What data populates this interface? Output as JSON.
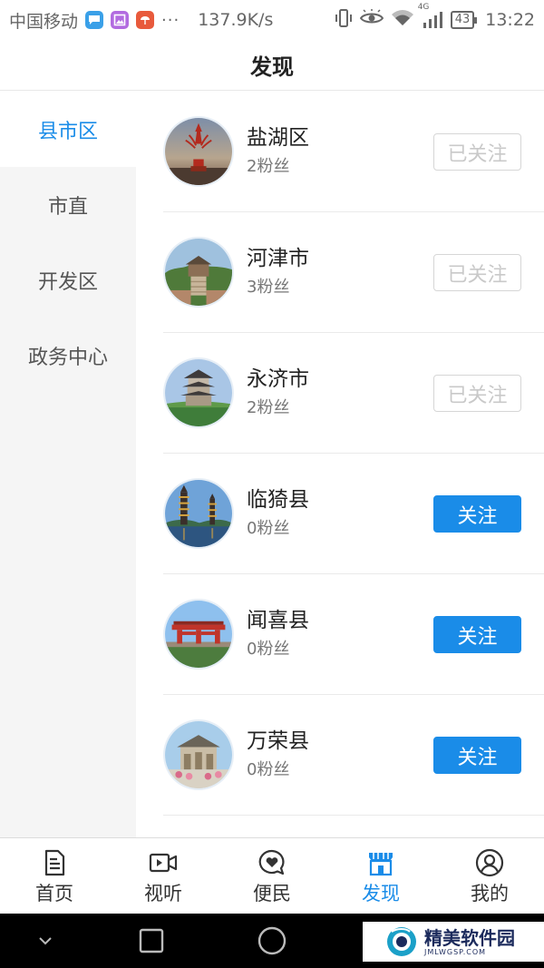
{
  "status_bar": {
    "carrier": "中国移动",
    "more": "···",
    "speed": "137.9K/s",
    "network": "4G",
    "battery": "43",
    "time": "13:22"
  },
  "header": {
    "title": "发现"
  },
  "sidebar": {
    "items": [
      {
        "label": "县市区",
        "active": true
      },
      {
        "label": "市直",
        "active": false
      },
      {
        "label": "开发区",
        "active": false
      },
      {
        "label": "政务中心",
        "active": false
      }
    ]
  },
  "list": {
    "items": [
      {
        "name": "盐湖区",
        "fans": "2粉丝",
        "button": "已关注",
        "followed": true
      },
      {
        "name": "河津市",
        "fans": "3粉丝",
        "button": "已关注",
        "followed": true
      },
      {
        "name": "永济市",
        "fans": "2粉丝",
        "button": "已关注",
        "followed": true
      },
      {
        "name": "临猗县",
        "fans": "0粉丝",
        "button": "关注",
        "followed": false
      },
      {
        "name": "闻喜县",
        "fans": "0粉丝",
        "button": "关注",
        "followed": false
      },
      {
        "name": "万荣县",
        "fans": "0粉丝",
        "button": "关注",
        "followed": false
      }
    ]
  },
  "tabbar": {
    "tabs": [
      {
        "label": "首页",
        "icon": "document-icon",
        "active": false
      },
      {
        "label": "视听",
        "icon": "video-icon",
        "active": false
      },
      {
        "label": "便民",
        "icon": "heart-chat-icon",
        "active": false
      },
      {
        "label": "发现",
        "icon": "store-icon",
        "active": true
      },
      {
        "label": "我的",
        "icon": "user-icon",
        "active": false
      }
    ]
  },
  "watermark": {
    "name": "精美软件园",
    "url": "JMLWGSP.COM"
  },
  "colors": {
    "accent": "#1a8ce8",
    "sidebar_bg": "#f5f5f5",
    "followed_text": "#c9c9c9"
  }
}
